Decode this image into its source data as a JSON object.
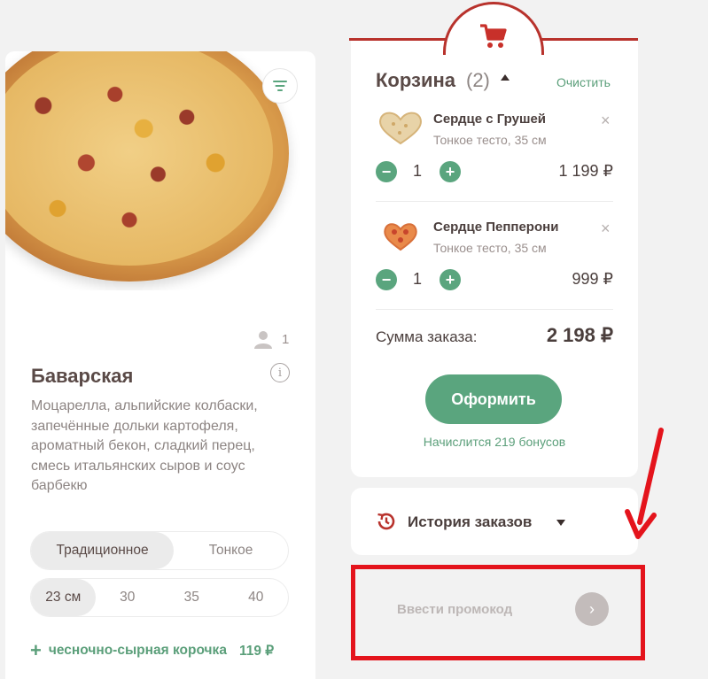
{
  "product": {
    "title": "Баварская",
    "description": "Моцарелла, альпийские колбаски, запечённые дольки картофеля, ароматный бекон, сладкий перец, смесь итальянских сыров и соус барбекю",
    "persons": "1",
    "info_glyph": "i",
    "dough_options": [
      "Традиционное",
      "Тонкое"
    ],
    "dough_selected": "Традиционное",
    "size_options": [
      "23 см",
      "30",
      "35",
      "40"
    ],
    "size_selected": "23 см",
    "crust": {
      "plus": "+",
      "label": "чесночно-сырная корочка",
      "price": "119 ₽"
    }
  },
  "cart": {
    "title": "Корзина",
    "count": "(2)",
    "clear_label": "Очистить",
    "items": [
      {
        "name": "Сердце с Грушей",
        "sub": "Тонкое тесто, 35 см",
        "qty": "1",
        "price": "1 199 ₽",
        "remove": "×",
        "minus": "−",
        "plus": "+"
      },
      {
        "name": "Сердце Пепперони",
        "sub": "Тонкое тесто, 35 см",
        "qty": "1",
        "price": "999 ₽",
        "remove": "×",
        "minus": "−",
        "plus": "+"
      }
    ],
    "sum_label": "Сумма заказа:",
    "sum_value": "2 198 ₽",
    "checkout_label": "Оформить",
    "bonus_text": "Начислится 219 бонусов"
  },
  "history": {
    "label": "История заказов"
  },
  "promo": {
    "placeholder": "Ввести промокод",
    "go_glyph": "›"
  },
  "colors": {
    "accent_green": "#5aa57e",
    "brand_red": "#b8322c",
    "highlight_red": "#e4141c"
  },
  "icons": [
    "filter-icon",
    "person-icon",
    "info-icon",
    "cart-icon",
    "close-icon",
    "history-icon",
    "chevron-right-icon",
    "arrow-annotation"
  ]
}
